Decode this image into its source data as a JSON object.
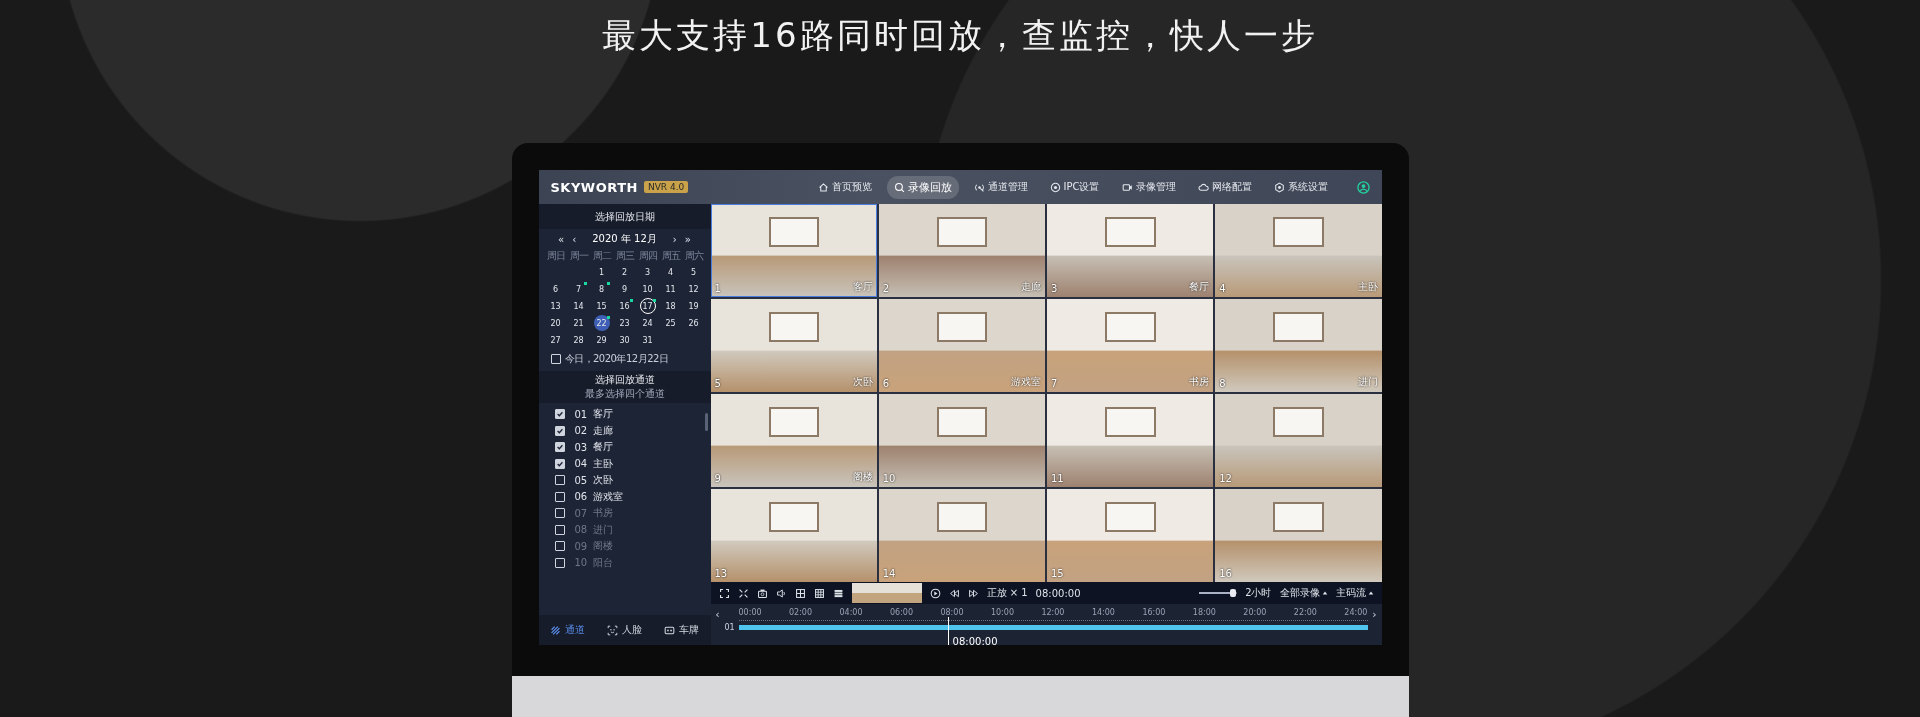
{
  "headline": "最大支持16路同时回放，查监控，快人一步",
  "app": {
    "logo": "SKYWORTH",
    "version_badge": "NVR 4.0",
    "nav": [
      {
        "label": "首页预览",
        "selected": false
      },
      {
        "label": "录像回放",
        "selected": true
      },
      {
        "label": "通道管理",
        "selected": false
      },
      {
        "label": "IPC设置",
        "selected": false
      },
      {
        "label": "录像管理",
        "selected": false
      },
      {
        "label": "网络配置",
        "selected": false
      },
      {
        "label": "系统设置",
        "selected": false
      }
    ],
    "date_panel": {
      "title": "选择回放日期",
      "prev_year": "«",
      "prev_month": "‹",
      "month": "2020 年 12月",
      "next_month": "›",
      "next_year": "»",
      "weekdays": [
        "周日",
        "周一",
        "周二",
        "周三",
        "周四",
        "周五",
        "周六"
      ],
      "weeks": [
        [
          {
            "day": "1",
            "has_record": false,
            "selected": false,
            "today": false
          },
          {
            "day": "2",
            "has_record": false,
            "selected": false,
            "today": false
          },
          {
            "day": "3",
            "has_record": false,
            "selected": false,
            "today": false
          },
          {
            "day": "4",
            "has_record": false,
            "selected": false,
            "today": false
          },
          {
            "day": "5",
            "has_record": false,
            "selected": false,
            "today": false
          }
        ],
        [
          {
            "day": "6",
            "has_record": false,
            "selected": false,
            "today": false
          },
          {
            "day": "7",
            "has_record": true,
            "selected": false,
            "today": false
          },
          {
            "day": "8",
            "has_record": true,
            "selected": false,
            "today": false
          },
          {
            "day": "9",
            "has_record": false,
            "selected": false,
            "today": false
          },
          {
            "day": "10",
            "has_record": false,
            "selected": false,
            "today": false
          },
          {
            "day": "11",
            "has_record": false,
            "selected": false,
            "today": false
          },
          {
            "day": "12",
            "has_record": false,
            "selected": false,
            "today": false
          }
        ],
        [
          {
            "day": "13",
            "has_record": false,
            "selected": false,
            "today": false
          },
          {
            "day": "14",
            "has_record": false,
            "selected": false,
            "today": false
          },
          {
            "day": "15",
            "has_record": false,
            "selected": false,
            "today": false
          },
          {
            "day": "16",
            "has_record": true,
            "selected": false,
            "today": false
          },
          {
            "day": "17",
            "has_record": true,
            "selected": false,
            "today": true
          },
          {
            "day": "18",
            "has_record": false,
            "selected": false,
            "today": false
          },
          {
            "day": "19",
            "has_record": false,
            "selected": false,
            "today": false
          }
        ],
        [
          {
            "day": "20",
            "has_record": false,
            "selected": false,
            "today": false
          },
          {
            "day": "21",
            "has_record": false,
            "selected": false,
            "today": false
          },
          {
            "day": "22",
            "has_record": true,
            "selected": true,
            "today": false
          },
          {
            "day": "23",
            "has_record": false,
            "selected": false,
            "today": false
          },
          {
            "day": "24",
            "has_record": false,
            "selected": false,
            "today": false
          },
          {
            "day": "25",
            "has_record": false,
            "selected": false,
            "today": false
          },
          {
            "day": "26",
            "has_record": false,
            "selected": false,
            "today": false
          }
        ],
        [
          {
            "day": "27",
            "has_record": false,
            "selected": false,
            "today": false
          },
          {
            "day": "28",
            "has_record": false,
            "selected": false,
            "today": false
          },
          {
            "day": "29",
            "has_record": false,
            "selected": false,
            "today": false
          },
          {
            "day": "30",
            "has_record": false,
            "selected": false,
            "today": false
          },
          {
            "day": "31",
            "has_record": false,
            "selected": false,
            "today": false
          }
        ]
      ],
      "today_option": {
        "label": "今日，2020年12月22日",
        "checked": false
      }
    },
    "channel_panel": {
      "title": "选择回放通道",
      "hint": "最多选择四个通道",
      "channels": [
        {
          "number": "01",
          "name": "客厅",
          "checked": true,
          "disabled": false
        },
        {
          "number": "02",
          "name": "走廊",
          "checked": true,
          "disabled": false
        },
        {
          "number": "03",
          "name": "餐厅",
          "checked": true,
          "disabled": false
        },
        {
          "number": "04",
          "name": "主卧",
          "checked": true,
          "disabled": false
        },
        {
          "number": "05",
          "name": "次卧",
          "checked": false,
          "disabled": false
        },
        {
          "number": "06",
          "name": "游戏室",
          "checked": false,
          "disabled": false
        },
        {
          "number": "07",
          "name": "书房",
          "checked": false,
          "disabled": true
        },
        {
          "number": "08",
          "name": "进门",
          "checked": false,
          "disabled": true
        },
        {
          "number": "09",
          "name": "阁楼",
          "checked": false,
          "disabled": true
        },
        {
          "number": "10",
          "name": "阳台",
          "checked": false,
          "disabled": true
        }
      ]
    },
    "bottom_tabs": [
      {
        "label": "通道",
        "selected": true
      },
      {
        "label": "人脸",
        "selected": false
      },
      {
        "label": "车牌",
        "selected": false
      }
    ],
    "feeds": [
      {
        "number": "1",
        "label": "客厅",
        "selected": true
      },
      {
        "number": "2",
        "label": "走廊",
        "selected": false
      },
      {
        "number": "3",
        "label": "餐厅",
        "selected": false
      },
      {
        "number": "4",
        "label": "主卧",
        "selected": false
      },
      {
        "number": "5",
        "label": "次卧",
        "selected": false
      },
      {
        "number": "6",
        "label": "游戏室",
        "selected": false
      },
      {
        "number": "7",
        "label": "书房",
        "selected": false
      },
      {
        "number": "8",
        "label": "进门",
        "selected": false
      },
      {
        "number": "9",
        "label": "阁楼",
        "selected": false
      },
      {
        "number": "10",
        "selected": false
      },
      {
        "number": "11",
        "selected": false
      },
      {
        "number": "12",
        "selected": false
      },
      {
        "number": "13",
        "selected": false
      },
      {
        "number": "14",
        "selected": false
      },
      {
        "number": "15",
        "selected": false
      },
      {
        "number": "16",
        "selected": false
      }
    ],
    "toolbar": {
      "speed": "正放 × 1",
      "time": "08:00:00",
      "zoom_slider": {
        "level": 0.9
      },
      "zoom_label": "2小时",
      "record_type": "全部录像",
      "stream": "主码流"
    },
    "timeline": {
      "prev": "‹",
      "next": "›",
      "ticks": [
        "00:00",
        "02:00",
        "04:00",
        "06:00",
        "08:00",
        "10:00",
        "12:00",
        "14:00",
        "16:00",
        "18:00",
        "20:00",
        "22:00",
        "24:00"
      ],
      "channel": "01",
      "playhead": {
        "level": 0.333,
        "time": "08:00:00"
      }
    }
  }
}
